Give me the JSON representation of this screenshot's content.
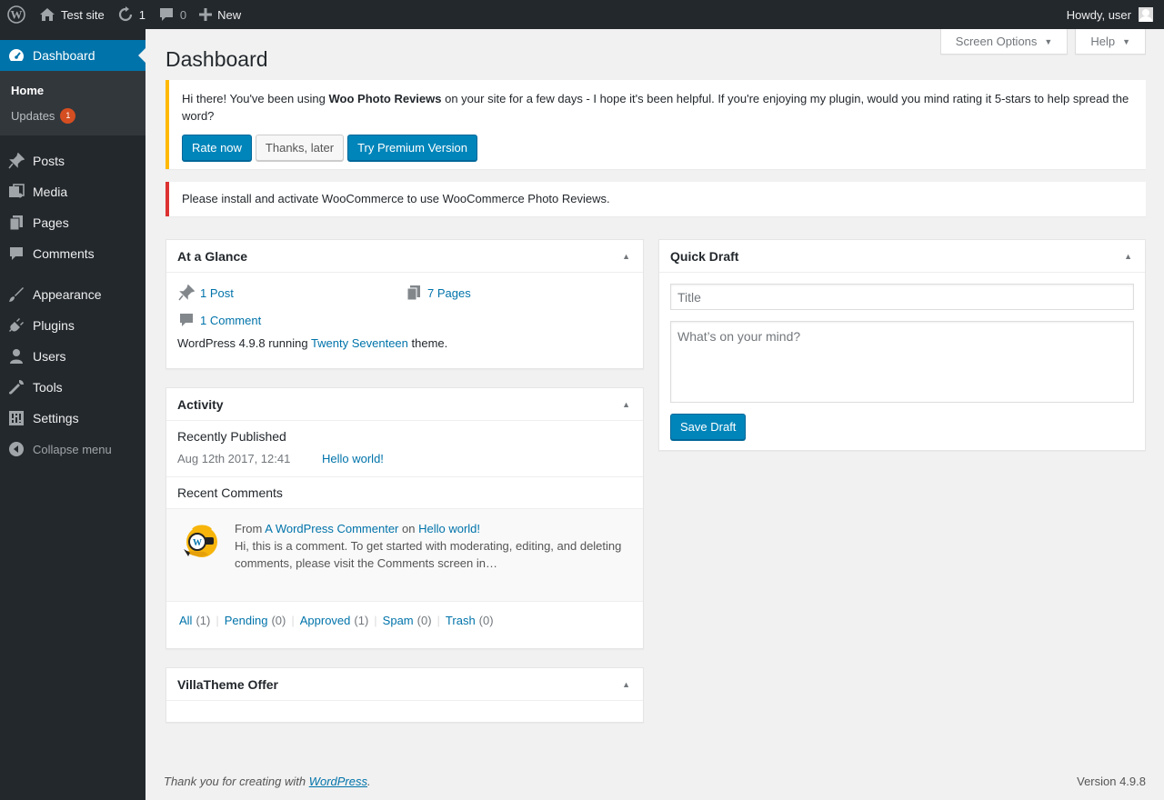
{
  "adminbar": {
    "site_name": "Test site",
    "updates_count": "1",
    "comments_count": "0",
    "new_label": "New",
    "howdy": "Howdy, user"
  },
  "sidebar": {
    "dashboard_label": "Dashboard",
    "home_label": "Home",
    "updates_label": "Updates",
    "updates_badge": "1",
    "items": [
      {
        "label": "Posts",
        "icon": "pin-icon"
      },
      {
        "label": "Media",
        "icon": "media-icon"
      },
      {
        "label": "Pages",
        "icon": "pages-icon"
      },
      {
        "label": "Comments",
        "icon": "comment-icon"
      },
      {
        "label": "Appearance",
        "icon": "brush-icon"
      },
      {
        "label": "Plugins",
        "icon": "plugin-icon"
      },
      {
        "label": "Users",
        "icon": "user-icon"
      },
      {
        "label": "Tools",
        "icon": "wrench-icon"
      },
      {
        "label": "Settings",
        "icon": "settings-icon"
      },
      {
        "label": "Collapse menu",
        "icon": "collapse-icon"
      }
    ]
  },
  "header": {
    "screen_options": "Screen Options",
    "help": "Help",
    "title": "Dashboard"
  },
  "notices": {
    "review_text_before": "Hi there! You've been using ",
    "review_plugin": "Woo Photo Reviews",
    "review_text_after": " on your site for a few days - I hope it's been helpful. If you're enjoying my plugin, would you mind rating it 5-stars to help spread the word?",
    "rate_now": "Rate now",
    "thanks_later": "Thanks, later",
    "try_premium": "Try Premium Version",
    "error_text": "Please install and activate WooCommerce to use WooCommerce Photo Reviews."
  },
  "glance": {
    "title": "At a Glance",
    "posts": "1 Post",
    "pages": "7 Pages",
    "comments": "1 Comment",
    "footer_before": "WordPress 4.9.8 running ",
    "theme": "Twenty Seventeen",
    "footer_after": " theme."
  },
  "activity": {
    "title": "Activity",
    "recently_published": "Recently Published",
    "post_date": "Aug 12th 2017, 12:41",
    "post_title": "Hello world!",
    "recent_comments": "Recent Comments",
    "comment_from": "From",
    "comment_author": "A WordPress Commenter",
    "comment_on": "on",
    "comment_post": "Hello world!",
    "comment_excerpt": "Hi, this is a comment. To get started with moderating, editing, and deleting comments, please visit the Comments screen in…",
    "links": [
      {
        "label": "All",
        "count": "(1)"
      },
      {
        "label": "Pending",
        "count": "(0)"
      },
      {
        "label": "Approved",
        "count": "(1)"
      },
      {
        "label": "Spam",
        "count": "(0)"
      },
      {
        "label": "Trash",
        "count": "(0)"
      }
    ]
  },
  "villa": {
    "title": "VillaTheme Offer"
  },
  "draft": {
    "title": "Quick Draft",
    "title_placeholder": "Title",
    "content_placeholder": "What’s on your mind?",
    "save": "Save Draft"
  },
  "footer": {
    "thanks_before": "Thank you for creating with ",
    "wordpress": "WordPress",
    "thanks_after": ".",
    "version": "Version 4.9.8"
  },
  "colors": {
    "adminbar_bg": "#23282d",
    "accent": "#0073aa",
    "warning_border": "#ffb900",
    "error_border": "#dc3232",
    "badge": "#d54e21"
  }
}
